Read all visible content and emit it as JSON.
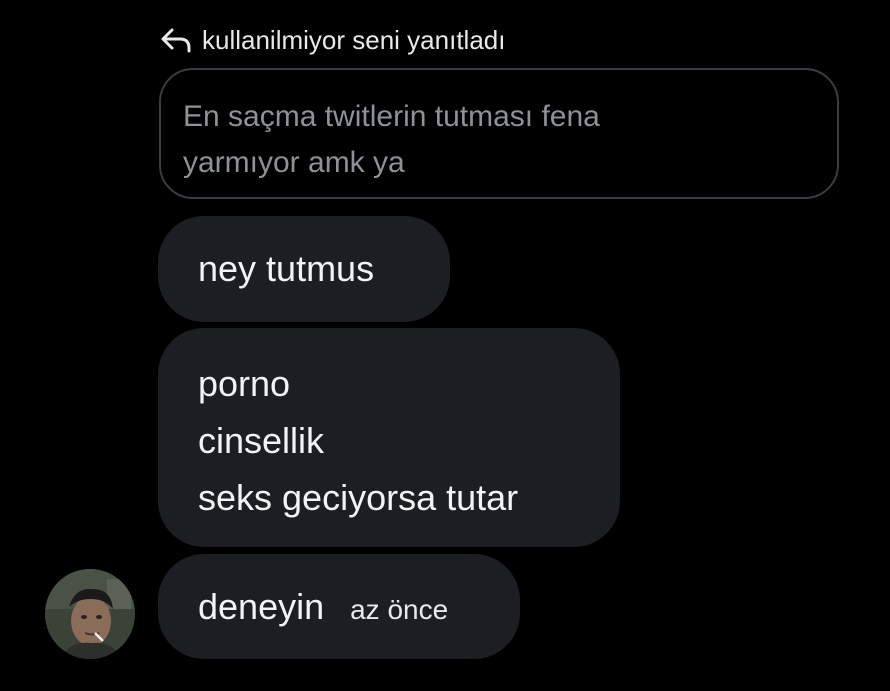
{
  "reply_header": {
    "icon": "reply-arrow-icon",
    "text": "kullanilmiyor seni yanıtladı"
  },
  "quoted_message": {
    "line1": "En saçma twitlerin tutması fena",
    "line2": "yarmıyor amk ya"
  },
  "messages": [
    {
      "text": "ney tutmus"
    },
    {
      "lines": [
        "porno",
        "cinsellik",
        "seks geciyorsa tutar"
      ]
    },
    {
      "text": "deneyin",
      "time": "az önce"
    }
  ],
  "avatar": {
    "icon": "user-avatar-photo"
  },
  "colors": {
    "background": "#000000",
    "bubble": "#1d1e21",
    "quote_border": "#3a3d42",
    "quote_text": "#8e9196",
    "text": "#e7e9ea"
  }
}
